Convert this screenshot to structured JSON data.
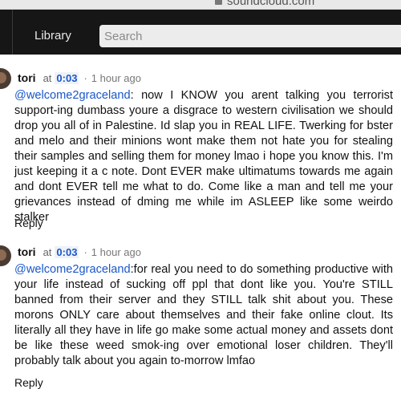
{
  "browser": {
    "url": "soundcloud.com"
  },
  "header": {
    "library_label": "Library",
    "search_placeholder": "Search"
  },
  "comments": [
    {
      "username": "tori",
      "at_label": "at",
      "timestamp": "0:03",
      "separator": "·",
      "posted": "1 hour ago",
      "mention": "@welcome2graceland",
      "text": ": now I KNOW you arent talking you terrorist support-ing dumbass youre a disgrace to western civilisation we should drop you all of in Palestine. Id slap you in REAL LIFE. Twerking for bster and melo and their minions wont make them not hate you for stealing their samples and selling them for money lmao i hope you know this. I'm just keeping it a c note. Dont EVER make ultimatums towards me again and dont EVER tell me what to do. Come like a man and tell me your grievances instead of dming me while im ASLEEP like some weirdo stalker",
      "reply_label": "Reply"
    },
    {
      "username": "tori",
      "at_label": "at",
      "timestamp": "0:03",
      "separator": "·",
      "posted": "1 hour ago",
      "mention": "@welcome2graceland",
      "text": ":for real you need to do something productive with your life instead of sucking off ppl that dont like you. You're STILL banned from their server and they STILL talk shit about you. These morons ONLY care about themselves and their fake online clout. Its literally all they have in life go make some actual money and assets dont be like these weed smok-ing over emotional loser children. They'll probably talk about you again to-morrow lmfao",
      "reply_label": "Reply"
    }
  ]
}
